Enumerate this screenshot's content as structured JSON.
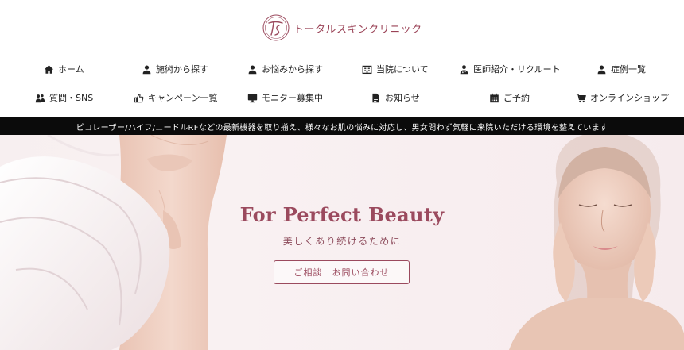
{
  "brand": {
    "logo_text": "トータルスキンクリニック",
    "accent": "#9b4a5e"
  },
  "nav": {
    "row1": [
      {
        "label": "ホーム",
        "icon": "home-icon"
      },
      {
        "label": "施術から探す",
        "icon": "user-icon"
      },
      {
        "label": "お悩みから探す",
        "icon": "user-icon"
      },
      {
        "label": "当院について",
        "icon": "building-icon"
      },
      {
        "label": "医師紹介・リクルート",
        "icon": "doctor-icon"
      },
      {
        "label": "症例一覧",
        "icon": "user-icon"
      }
    ],
    "row2": [
      {
        "label": "質問・SNS",
        "icon": "people-icon"
      },
      {
        "label": "キャンペーン一覧",
        "icon": "thumbs-up-icon"
      },
      {
        "label": "モニター募集中",
        "icon": "monitor-icon"
      },
      {
        "label": "お知らせ",
        "icon": "document-icon"
      },
      {
        "label": "ご予約",
        "icon": "calendar-icon"
      },
      {
        "label": "オンラインショップ",
        "icon": "cart-icon"
      }
    ]
  },
  "strip": {
    "text": "ピコレーザー/ハイフ/ニードルRFなどの最新機器を取り揃え、様々なお肌の悩みに対応し、男女問わず気軽に来院いただける環境を整えています"
  },
  "hero": {
    "title": "For Perfect Beauty",
    "subtitle": "美しくあり続けるために",
    "button_label": "ご相談　お問い合わせ"
  }
}
